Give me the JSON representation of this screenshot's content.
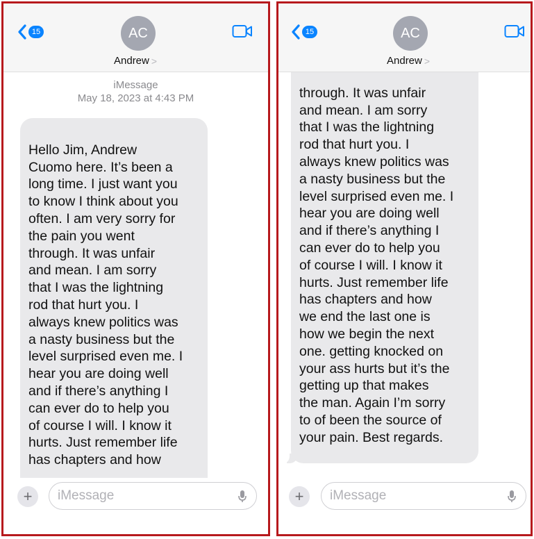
{
  "contact": {
    "initials": "AC",
    "name": "Andrew",
    "chevron": ">"
  },
  "header": {
    "badge_count": "15"
  },
  "thread": {
    "service": "iMessage",
    "date": "May 18, 2023 at 4:43 PM"
  },
  "panel1": {
    "message_lines": [
      "Hello Jim, Andrew",
      "Cuomo here. It’s been a",
      "long time. I just want you",
      "to know I think about you",
      "often. I am very sorry for",
      "the pain you went",
      "through. It was unfair",
      "and mean. I am sorry",
      "that I was the lightning",
      "rod that hurt you. I",
      "always knew politics was",
      "a nasty business but the",
      "level surprised even me. I",
      "hear you are doing well",
      "and if there’s anything I",
      "can ever do to help you",
      "of course I will. I know it",
      "hurts. Just remember life",
      "has chapters and how"
    ]
  },
  "panel2": {
    "message_lines": [
      "through. It was unfair",
      "and mean. I am sorry",
      "that I was the lightning",
      "rod that hurt you. I",
      "always knew politics was",
      "a nasty business but the",
      "level surprised even me. I",
      "hear you are doing well",
      "and if there’s anything I",
      "can ever do to help you",
      "of course I will. I know it",
      "hurts. Just remember life",
      "has chapters and how",
      "we end the last one is",
      "how we begin the next",
      "one. getting knocked on",
      "your ass hurts but it’s the",
      "getting up that makes",
      "the man. Again I’m sorry",
      "to of been the source of",
      "your pain. Best regards."
    ]
  },
  "composer": {
    "placeholder": "iMessage",
    "plus": "+"
  },
  "colors": {
    "accent": "#0a84ff",
    "bubble": "#e9e9eb",
    "frame": "#b7191d"
  },
  "icons": [
    "back-chevron-icon",
    "video-camera-icon",
    "plus-icon",
    "microphone-icon"
  ]
}
